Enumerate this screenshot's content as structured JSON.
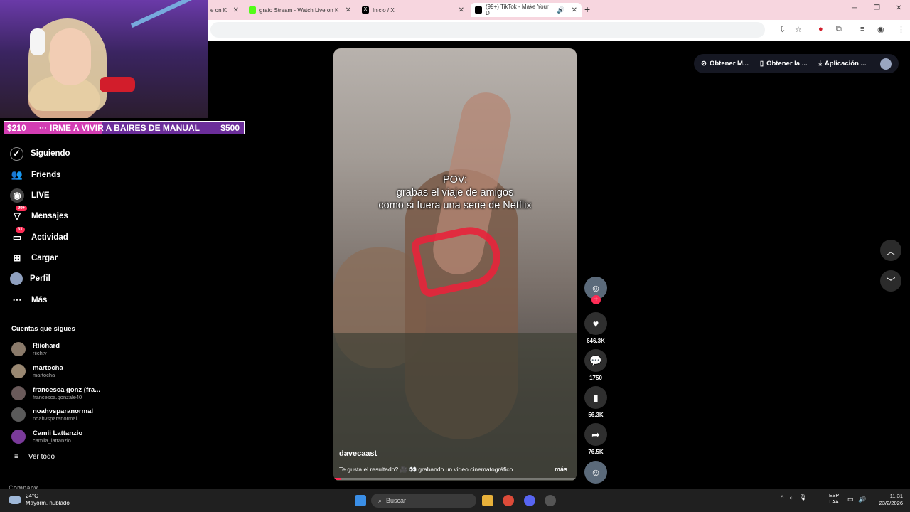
{
  "browser": {
    "tabs": [
      {
        "label": "e on K",
        "favicon_color": "#ffffff"
      },
      {
        "label": "grafo Stream - Watch Live on K",
        "favicon_color": "#53fc18"
      },
      {
        "label": "Inicio / X",
        "favicon_color": "#000000"
      },
      {
        "label": "(99+) TikTok - Make Your D",
        "favicon_color": "#000000",
        "active": true
      }
    ],
    "new_tab": "+"
  },
  "stream_overlay": {
    "goal_left": "$210",
    "goal_text": "IRME A VIVIR A BAIRES DE MANUAL",
    "goal_right": "$500"
  },
  "sidebar": {
    "items": [
      {
        "label": "Siguiendo",
        "icon": "following-icon"
      },
      {
        "label": "Friends",
        "icon": "friends-icon"
      },
      {
        "label": "LIVE",
        "icon": "live-icon"
      },
      {
        "label": "Mensajes",
        "icon": "messages-icon",
        "badge": "99+"
      },
      {
        "label": "Actividad",
        "icon": "activity-icon",
        "badge": "31"
      },
      {
        "label": "Cargar",
        "icon": "upload-icon"
      },
      {
        "label": "Perfil",
        "icon": "profile-icon"
      },
      {
        "label": "Más",
        "icon": "more-icon"
      }
    ],
    "following_title": "Cuentas que sigues",
    "accounts": [
      {
        "name": "Riichard",
        "handle": "riichtv"
      },
      {
        "name": "martocha__",
        "handle": "martocha__"
      },
      {
        "name": "francesca gonz (fra...",
        "handle": "francesca.gonzale40"
      },
      {
        "name": "noahvsparanormal",
        "handle": "noahvsparanormal"
      },
      {
        "name": "Camii Lattanzio",
        "handle": "camila_lattanzio"
      }
    ],
    "see_all": "Ver todo",
    "company": "Company"
  },
  "top_actions": {
    "coins": "Obtener M...",
    "app": "Obtener la ...",
    "download": "Aplicación ..."
  },
  "video": {
    "caption_line1": "POV:",
    "caption_line2": "grabas el viaje de amigos",
    "caption_line3": "como si fuera una serie de Netflix",
    "author": "davecaast",
    "description": "Te gusta el resultado? 🎥 👀 grabando un video cinematográfico",
    "more": "más",
    "progress": 0.03
  },
  "actions": {
    "likes": "646.3K",
    "comments": "1750",
    "saves": "56.3K",
    "shares": "76.5K"
  },
  "taskbar": {
    "temperature": "24°C",
    "weather": "Mayorm. nublado",
    "search_placeholder": "Buscar",
    "lang1": "ESP",
    "lang2": "LAA",
    "time": "11:31",
    "date": "23/2/2026"
  }
}
